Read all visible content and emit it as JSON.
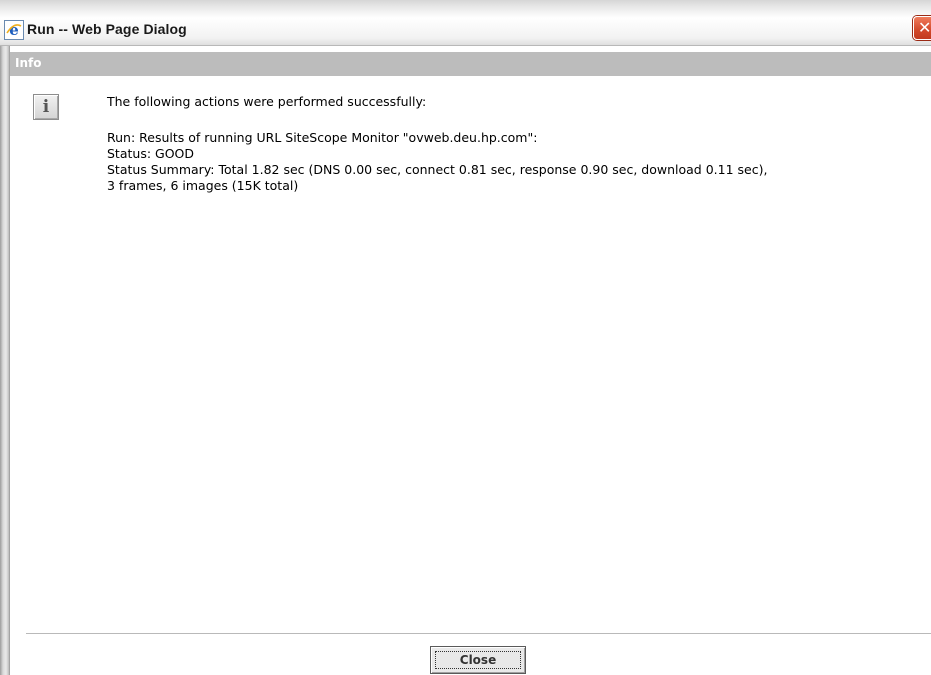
{
  "window": {
    "title": "Run -- Web Page Dialog",
    "close_glyph": "✕"
  },
  "header": {
    "label": "Info"
  },
  "icons": {
    "app": "ie-icon",
    "info": "info-icon",
    "info_glyph": "i"
  },
  "message": {
    "intro": "The following actions were performed successfully:",
    "lines": [
      "Run: Results of running URL SiteScope Monitor \"ovweb.deu.hp.com\":",
      "Status: GOOD",
      "Status Summary: Total 1.82 sec (DNS 0.00 sec, connect 0.81 sec, response 0.90 sec, download 0.11 sec),",
      "3 frames, 6 images (15K total)"
    ]
  },
  "footer": {
    "close_label": "Close"
  }
}
